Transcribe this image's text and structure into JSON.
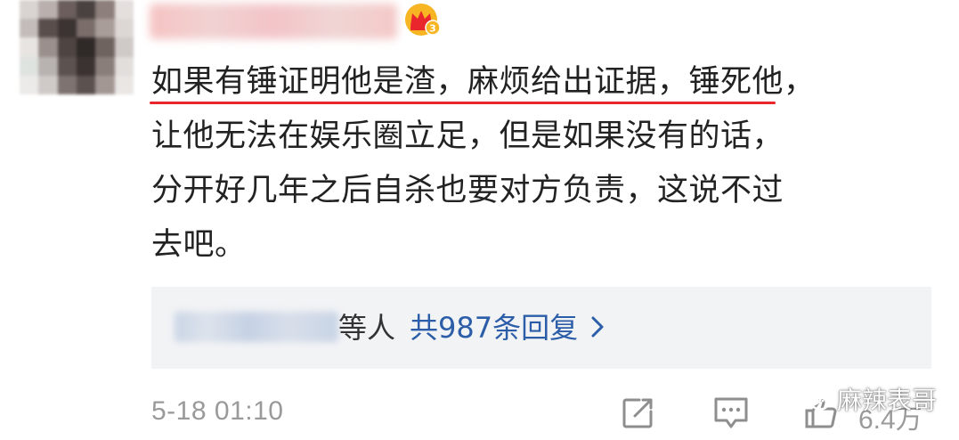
{
  "user": {
    "avatar_label": "avatar",
    "vip_level": "3"
  },
  "comment": {
    "lines": [
      "如果有锤证明他是渣，麻烦给出证据，锤死他，",
      "让他无法在娱乐圈立足，但是如果没有的话，",
      "分开好几年之后自杀也要对方负责，这说不过",
      "去吧。"
    ]
  },
  "replies": {
    "others_label": "等人",
    "count_label": "共987条回复"
  },
  "footer": {
    "timestamp": "5-18 01:10",
    "like_count": "6.4万"
  },
  "watermark": {
    "text": "麻辣表哥"
  },
  "colors": {
    "text": "#222222",
    "underline": "#e8262c",
    "link": "#2b5da8",
    "meta": "#9a9a9a",
    "reply_bg": "#f2f3f5"
  }
}
